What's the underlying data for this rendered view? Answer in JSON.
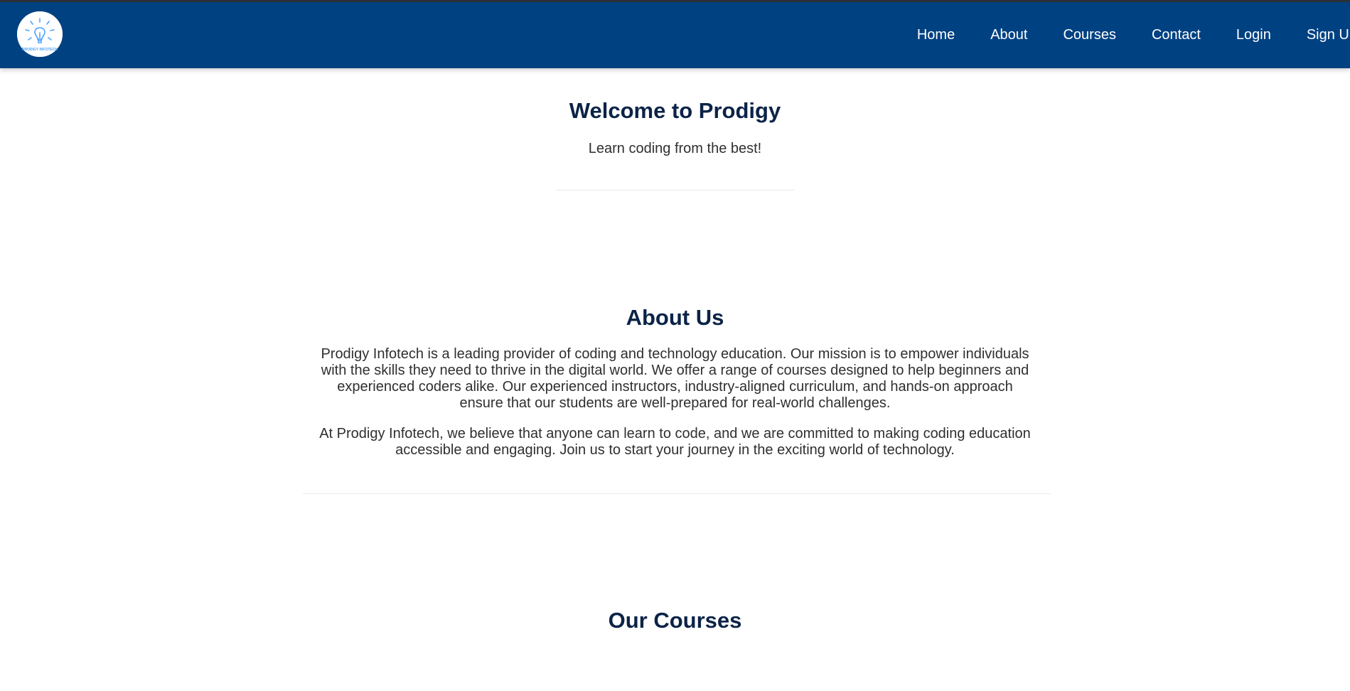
{
  "header": {
    "logo_text": "PRODIGY INFOTECH",
    "nav": {
      "home": "Home",
      "about": "About",
      "courses": "Courses",
      "contact": "Contact",
      "login": "Login",
      "signup": "Sign Up"
    }
  },
  "hero": {
    "title": "Welcome to Prodigy",
    "subtitle": "Learn coding from the best!"
  },
  "about": {
    "title": "About Us",
    "paragraph_1": "Prodigy Infotech is a leading provider of coding and technology education. Our mission is to empower individuals with the skills they need to thrive in the digital world. We offer a range of courses designed to help beginners and experienced coders alike. Our experienced instructors, industry-aligned curriculum, and hands-on approach ensure that our students are well-prepared for real-world challenges.",
    "paragraph_2": "At Prodigy Infotech, we believe that anyone can learn to code, and we are committed to making coding education accessible and engaging. Join us to start your journey in the exciting world of technology."
  },
  "courses": {
    "title": "Our Courses"
  },
  "colors": {
    "header_bg": "#004182",
    "heading": "#0b2347",
    "body_text": "#2f2f2f",
    "logo_accent": "#4da3ff"
  }
}
